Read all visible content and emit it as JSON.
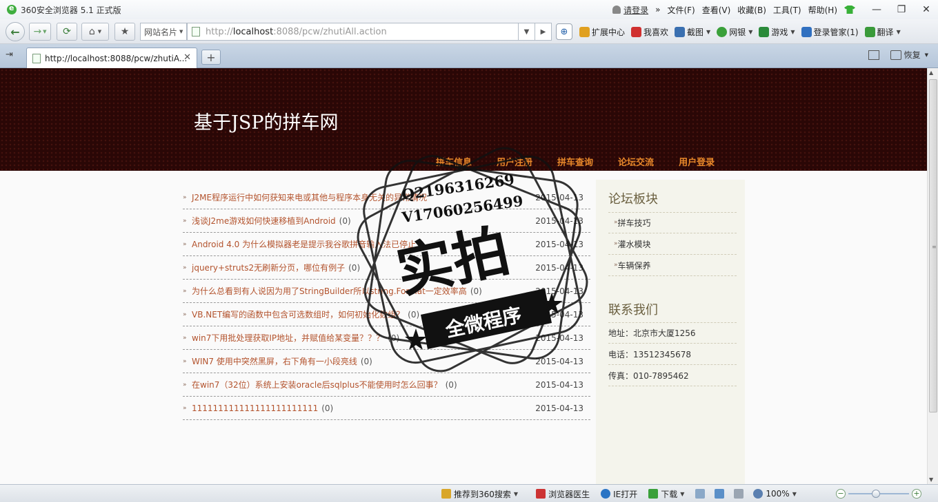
{
  "window": {
    "title": "360安全浏览器 5.1 正式版",
    "login": "请登录",
    "menus": [
      "文件(F)",
      "查看(V)",
      "收藏(B)",
      "工具(T)",
      "帮助(H)"
    ]
  },
  "toolbar": {
    "site_card_label": "网站名片",
    "url_prefix": "http://",
    "url_host": "localhost",
    "url_rest": ":8088/pcw/zhutiAll.action",
    "items": [
      {
        "label": "扩展中心",
        "icon": "extensions-icon",
        "color": "#e0a020"
      },
      {
        "label": "我喜欢",
        "icon": "favorite-icon",
        "color": "#d03030"
      },
      {
        "label": "截图",
        "icon": "screenshot-icon",
        "color": "#3a6fb0"
      },
      {
        "label": "网银",
        "icon": "bank-icon",
        "color": "#3aa03a"
      },
      {
        "label": "游戏",
        "icon": "game-icon",
        "color": "#2a8a3a"
      },
      {
        "label": "登录管家(1)",
        "icon": "login-manager-icon",
        "color": "#3070c0"
      },
      {
        "label": "翻译",
        "icon": "translate-icon",
        "color": "#3a9a3a"
      }
    ]
  },
  "tab": {
    "title": "http://localhost:8088/pcw/zhutiA...",
    "restore_label": "恢复"
  },
  "site": {
    "title": "基于JSP的拼车网",
    "nav": [
      "拼车信息",
      "用户注册",
      "拼车查询",
      "论坛交流",
      "用户登录"
    ]
  },
  "topics": [
    {
      "title": "J2ME程序运行中如何获知来电或其他与程序本身无关的异常情况",
      "count": "",
      "date": "2015-04-13"
    },
    {
      "title": "浅谈J2me游戏如何快速移植到Android",
      "count": "(0)",
      "date": "2015-04-13"
    },
    {
      "title": "Android 4.0 为什么模拟器老是提示我谷歌拼音输入法已停止",
      "count": "",
      "date": "2015-04-13"
    },
    {
      "title": "jquery+struts2无刷新分页，哪位有例子",
      "count": "(0)",
      "date": "2015-04-13"
    },
    {
      "title": "为什么总看到有人说因为用了StringBuilder所以string.Format一定效率高",
      "count": "(0)",
      "date": "2015-04-13"
    },
    {
      "title": "VB.NET编写的函数中包含可选数组时，如何初始化数组？",
      "count": "(0)",
      "date": "2015-04-13"
    },
    {
      "title": "win7下用批处理获取IP地址，并赋值给某变量？？？",
      "count": "(0)",
      "date": "2015-04-13"
    },
    {
      "title": "WIN7 使用中突然黑屏，右下角有一小段亮线",
      "count": "(0)",
      "date": "2015-04-13"
    },
    {
      "title": "在win7（32位）系统上安装oracle后sqlplus不能使用时怎么回事？",
      "count": "(0)",
      "date": "2015-04-13"
    },
    {
      "title": "111111111111111111111111",
      "count": "(0)",
      "date": "2015-04-13"
    }
  ],
  "sidebar": {
    "forum_heading": "论坛板块",
    "forum_items": [
      "拼车技巧",
      "灌水模块",
      "车辆保养"
    ],
    "contact_heading": "联系我们",
    "contact_items": [
      "地址：北京市大厦1256",
      "电话：13512345678",
      "传真：010-7895462"
    ]
  },
  "watermark": {
    "qq": "Q2196316269",
    "vx": "V17060256499",
    "main": "实拍",
    "sub": "全微程序"
  },
  "statusbar": {
    "items": [
      {
        "label": "推荐到360搜索",
        "icon": "recommend-icon",
        "color": "#d9a62a"
      },
      {
        "label": "浏览器医生",
        "icon": "doctor-icon",
        "color": "#cc3333"
      },
      {
        "label": "IE打开",
        "icon": "ie-icon",
        "color": "#2a74c4"
      },
      {
        "label": "下载",
        "icon": "download-icon",
        "color": "#3aa03a"
      }
    ],
    "zoom": "100%"
  }
}
